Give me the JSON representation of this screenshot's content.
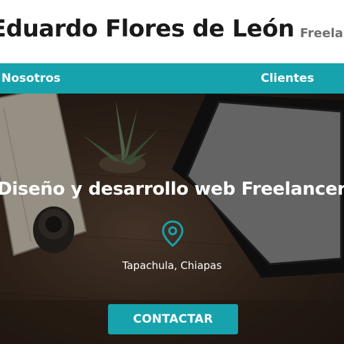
{
  "header": {
    "site_title": "Eduardo Flores de León",
    "tagline": "Freelancer"
  },
  "nav": {
    "items": [
      {
        "label": "Nosotros"
      },
      {
        "label": "Clientes"
      }
    ]
  },
  "hero": {
    "heading": "Diseño y desarrollo web Freelancer",
    "location": "Tapachula, Chiapas",
    "contact_button": "CONTACTAR"
  },
  "colors": {
    "accent": "#16a3ad",
    "header_bg": "#ffffff",
    "text_dark": "#1a1a1a",
    "tagline": "#6f6f6f"
  },
  "icons": {
    "location": "map-pin-icon"
  }
}
